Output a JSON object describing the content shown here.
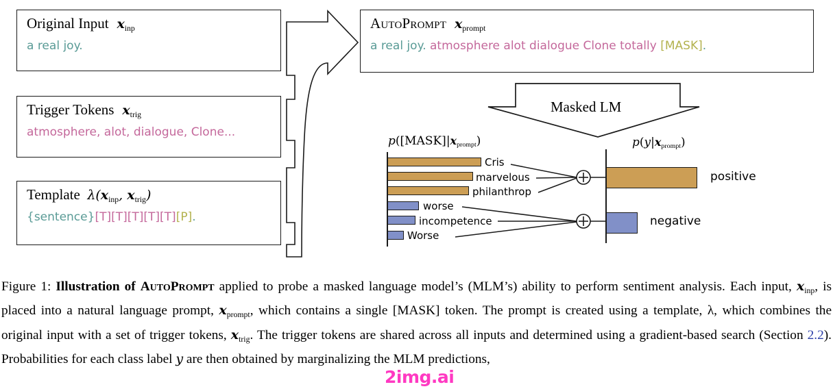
{
  "figure": {
    "number": "Figure 1:",
    "caption_bold": "Illustration of",
    "caption_smallcaps": "AutoPrompt",
    "caption_rest_1": " applied to probe a masked language model’s (MLM’s) ability to perform sentiment analysis. Each input, ",
    "caption_rest_2": ", is placed into a natural language prompt, ",
    "caption_rest_3": ", which contains a single [MASK] token. The prompt is created using a template, λ, which combines the original input with a set of trigger tokens, ",
    "caption_rest_4": ". The trigger tokens are shared across all inputs and determined using a gradient-based search (Section ",
    "caption_section_ref": "2.2",
    "caption_rest_5": "). Probabilities for each class label ",
    "caption_rest_6": " are then obtained by marginalizing the MLM predictions,"
  },
  "boxes": {
    "original_input": {
      "title": "Original Input",
      "var": "x",
      "var_sub": "inp",
      "body_input": "a real joy."
    },
    "trigger_tokens": {
      "title": "Trigger Tokens",
      "var": "x",
      "var_sub": "trig",
      "body_triggers": "atmosphere, alot, dialogue, Clone..."
    },
    "template": {
      "title": "Template",
      "lambda": "λ(",
      "var1": "x",
      "var1_sub": "inp",
      "comma": ", ",
      "var2": "x",
      "var2_sub": "trig",
      "close": ")",
      "body_sentence": "{sentence}",
      "body_t_tokens": "[T][T][T][T][T]",
      "body_p_token": "[P]",
      "body_period": "."
    },
    "autoprompt": {
      "title": "AutoPrompt",
      "var": "x",
      "var_sub": "prompt",
      "body_input": "a real joy.",
      "body_triggers": "atmosphere alot dialogue Clone totally",
      "body_mask": "[MASK]",
      "body_period": "."
    }
  },
  "masked_lm": {
    "label": "Masked LM"
  },
  "operators": {
    "plus_positive": "+",
    "plus_negative": "+"
  },
  "chart_data": {
    "type": "bar",
    "title": "",
    "panels": [
      {
        "name": "mask-distribution",
        "axis_title": "p([MASK]|x_prompt)",
        "axis_title_p": "p",
        "axis_title_mask": "([MASK]|",
        "axis_title_var": "x",
        "axis_title_sub": "prompt",
        "axis_title_close": ")",
        "orientation": "horizontal",
        "categories": [
          "Cris",
          "marvelous",
          "philanthrop",
          "worse",
          "incompetence",
          "Worse"
        ],
        "values": [
          0.99,
          0.9,
          0.86,
          0.33,
          0.29,
          0.13
        ],
        "colors": [
          "#cc9e55",
          "#cc9e55",
          "#cc9e55",
          "#8190c8",
          "#8190c8",
          "#8190c8"
        ],
        "groups": [
          "positive",
          "positive",
          "positive",
          "negative",
          "negative",
          "negative"
        ],
        "xlim": [
          0,
          1
        ],
        "grid": false
      },
      {
        "name": "class-distribution",
        "axis_title": "p(y|x_prompt)",
        "axis_title_p": "p",
        "axis_title_open": "(",
        "axis_title_y": "y",
        "axis_title_bar": "|",
        "axis_title_var": "x",
        "axis_title_sub": "prompt",
        "axis_title_close": ")",
        "orientation": "horizontal",
        "categories": [
          "positive",
          "negative"
        ],
        "values": [
          0.77,
          0.26
        ],
        "colors": [
          "#cc9e55",
          "#8190c8"
        ],
        "xlim": [
          0,
          1
        ],
        "grid": false
      }
    ]
  },
  "colors": {
    "orange_bar": "#cc9e55",
    "blue_bar": "#8190c8",
    "input_text": "#5a9b96",
    "trigger_text": "#c4689b",
    "mask_text": "#b3b24e",
    "reference_link": "#2b3ea8",
    "watermark": "#ff2fbf"
  },
  "watermark": {
    "text": "2img.ai"
  }
}
